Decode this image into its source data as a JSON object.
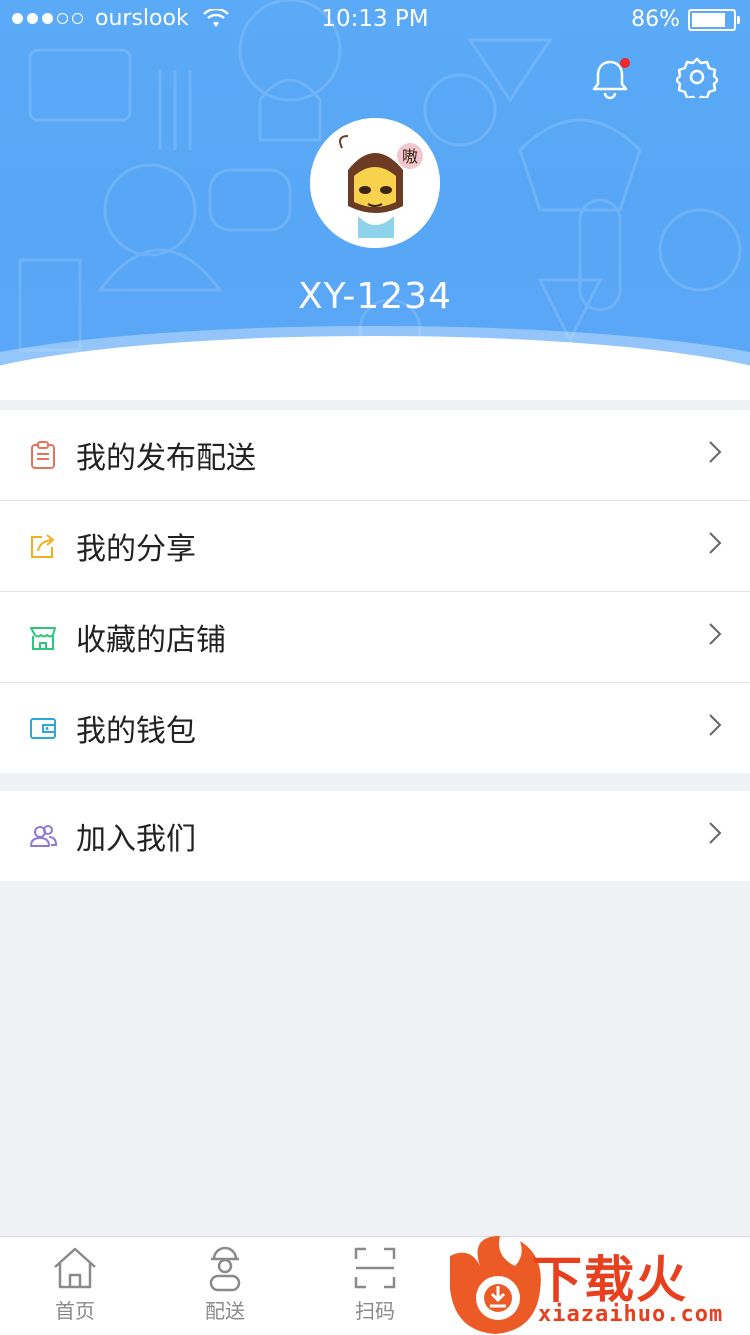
{
  "status_bar": {
    "carrier": "ourslook",
    "time": "10:13 PM",
    "battery_percent": "86%",
    "battery_level": 0.86,
    "signal_dots_filled": 3,
    "signal_dots_total": 5
  },
  "profile": {
    "username": "XY-1234",
    "avatar_badge": "嗷",
    "has_notification": true
  },
  "menu_group_1": [
    {
      "label": "我的发布配送",
      "icon": "clipboard-icon",
      "color": "#e8735d"
    },
    {
      "label": "我的分享",
      "icon": "share-icon",
      "color": "#f2b01e"
    },
    {
      "label": "收藏的店铺",
      "icon": "store-icon",
      "color": "#2dc77b"
    },
    {
      "label": "我的钱包",
      "icon": "wallet-icon",
      "color": "#2aa7dd"
    }
  ],
  "menu_group_2": [
    {
      "label": "加入我们",
      "icon": "users-icon",
      "color": "#8f78d6"
    }
  ],
  "tabbar": [
    {
      "label": "首页",
      "icon": "home-icon"
    },
    {
      "label": "配送",
      "icon": "courier-icon"
    },
    {
      "label": "扫码",
      "icon": "scan-icon"
    }
  ],
  "watermark": {
    "text": "下载火",
    "domain": "xiazaihuo.com"
  },
  "colors": {
    "header_blue": "#5aa8f7",
    "background": "#eff1f5",
    "notification_red": "#f0262c",
    "watermark_red": "#e8401f"
  }
}
